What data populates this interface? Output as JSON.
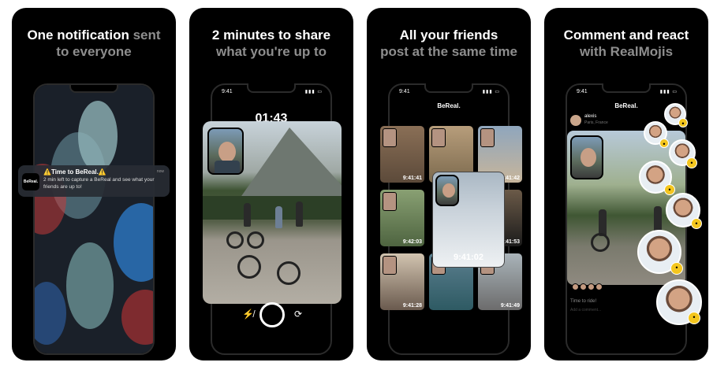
{
  "panels": [
    {
      "headline_white": "One notification",
      "headline_gray_inline": "sent",
      "headline_gray_line2": "to everyone",
      "notification": {
        "app_label": "BeReal.",
        "title": "⚠️Time to BeReal.⚠️",
        "body": "2 min left to capture a BeReal and see what your friends are up to!",
        "time": "now"
      }
    },
    {
      "headline_white": "2 minutes to share",
      "headline_gray": "what you're up to",
      "status_time": "9:41",
      "timer": "01:43"
    },
    {
      "headline_white": "All your friends",
      "headline_gray": "post at the same time",
      "status_time": "9:41",
      "brand": "BeReal.",
      "tile_times": [
        "9:41:41",
        "9:41:42",
        "9:42:03",
        "9:41:53",
        "9:41:28",
        "9:41:49"
      ],
      "center_time": "9:41:02"
    },
    {
      "headline_white": "Comment and react",
      "headline_gray": "with RealMojis",
      "status_time": "9:41",
      "brand": "BeReal.",
      "post_user": "alexis",
      "post_location": "Paris, France",
      "caption": "Time to ride!",
      "caption2": "Add a comment..."
    }
  ],
  "icons": {
    "flash": "flash-off-icon",
    "flip": "flip-camera-icon",
    "signal": "signal-icon",
    "battery": "battery-icon"
  },
  "colors": {
    "panel_bg": "#000000",
    "headline_white": "#ffffff",
    "headline_gray": "#8e8e8e",
    "emoji_badge": "#f4c61e"
  }
}
